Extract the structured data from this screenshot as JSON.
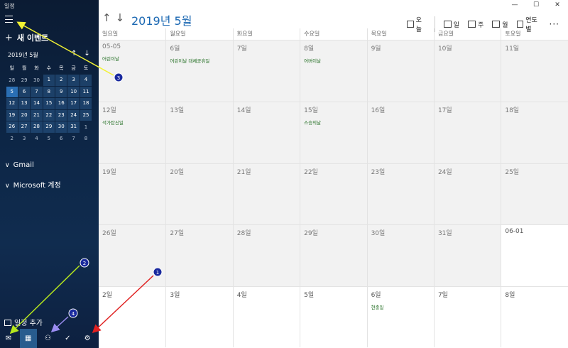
{
  "window": {
    "title": "일정",
    "controls": [
      "—",
      "☐",
      "✕"
    ]
  },
  "sidebar": {
    "new_event_label": "새 이벤트",
    "mini_calendar": {
      "title": "2019년 5월",
      "weekdays": [
        "일",
        "월",
        "화",
        "수",
        "목",
        "금",
        "토"
      ],
      "weeks": [
        [
          "28",
          "29",
          "30",
          "1",
          "2",
          "3",
          "4"
        ],
        [
          "5",
          "6",
          "7",
          "8",
          "9",
          "10",
          "11"
        ],
        [
          "12",
          "13",
          "14",
          "15",
          "16",
          "17",
          "18"
        ],
        [
          "19",
          "20",
          "21",
          "22",
          "23",
          "24",
          "25"
        ],
        [
          "26",
          "27",
          "28",
          "29",
          "30",
          "31",
          "1"
        ],
        [
          "2",
          "3",
          "4",
          "5",
          "6",
          "7",
          "8"
        ]
      ]
    },
    "accounts": [
      "Gmail",
      "Microsoft 계정"
    ],
    "add_calendar_label": "일정 추가"
  },
  "header": {
    "month_title": "2019년 5월",
    "toolbar": {
      "today": "오늘",
      "day": "일",
      "week": "주",
      "month": "월",
      "year": "연도별",
      "more": "···"
    }
  },
  "calendar": {
    "weekday_headers": [
      "일요일",
      "월요일",
      "화요일",
      "수요일",
      "목요일",
      "금요일",
      "토요일"
    ],
    "weeks": [
      [
        {
          "num": "05-05",
          "event": "어린이날"
        },
        {
          "num": "6일",
          "event": "어린이날 대체공휴일"
        },
        {
          "num": "7일",
          "event": ""
        },
        {
          "num": "8일",
          "event": "어버이날"
        },
        {
          "num": "9일",
          "event": ""
        },
        {
          "num": "10일",
          "event": ""
        },
        {
          "num": "11일",
          "event": ""
        }
      ],
      [
        {
          "num": "12일",
          "event": "석가탄신일"
        },
        {
          "num": "13일",
          "event": ""
        },
        {
          "num": "14일",
          "event": ""
        },
        {
          "num": "15일",
          "event": "스승의날"
        },
        {
          "num": "16일",
          "event": ""
        },
        {
          "num": "17일",
          "event": ""
        },
        {
          "num": "18일",
          "event": ""
        }
      ],
      [
        {
          "num": "19일",
          "event": ""
        },
        {
          "num": "20일",
          "event": ""
        },
        {
          "num": "21일",
          "event": ""
        },
        {
          "num": "22일",
          "event": ""
        },
        {
          "num": "23일",
          "event": ""
        },
        {
          "num": "24일",
          "event": ""
        },
        {
          "num": "25일",
          "event": ""
        }
      ],
      [
        {
          "num": "26일",
          "event": ""
        },
        {
          "num": "27일",
          "event": ""
        },
        {
          "num": "28일",
          "event": ""
        },
        {
          "num": "29일",
          "event": ""
        },
        {
          "num": "30일",
          "event": ""
        },
        {
          "num": "31일",
          "event": ""
        },
        {
          "num": "06-01",
          "event": ""
        }
      ],
      [
        {
          "num": "2일",
          "event": ""
        },
        {
          "num": "3일",
          "event": ""
        },
        {
          "num": "4일",
          "event": ""
        },
        {
          "num": "5일",
          "event": ""
        },
        {
          "num": "6일",
          "event": "현충일"
        },
        {
          "num": "7일",
          "event": ""
        },
        {
          "num": "8일",
          "event": ""
        }
      ]
    ]
  },
  "annotations": {
    "markers": [
      "1",
      "2",
      "3",
      "4"
    ],
    "colors": {
      "marker_1": "#e02020",
      "marker_2": "#b5e61d",
      "marker_3": "#f2f233",
      "marker_4": "#9a8cf0"
    }
  }
}
